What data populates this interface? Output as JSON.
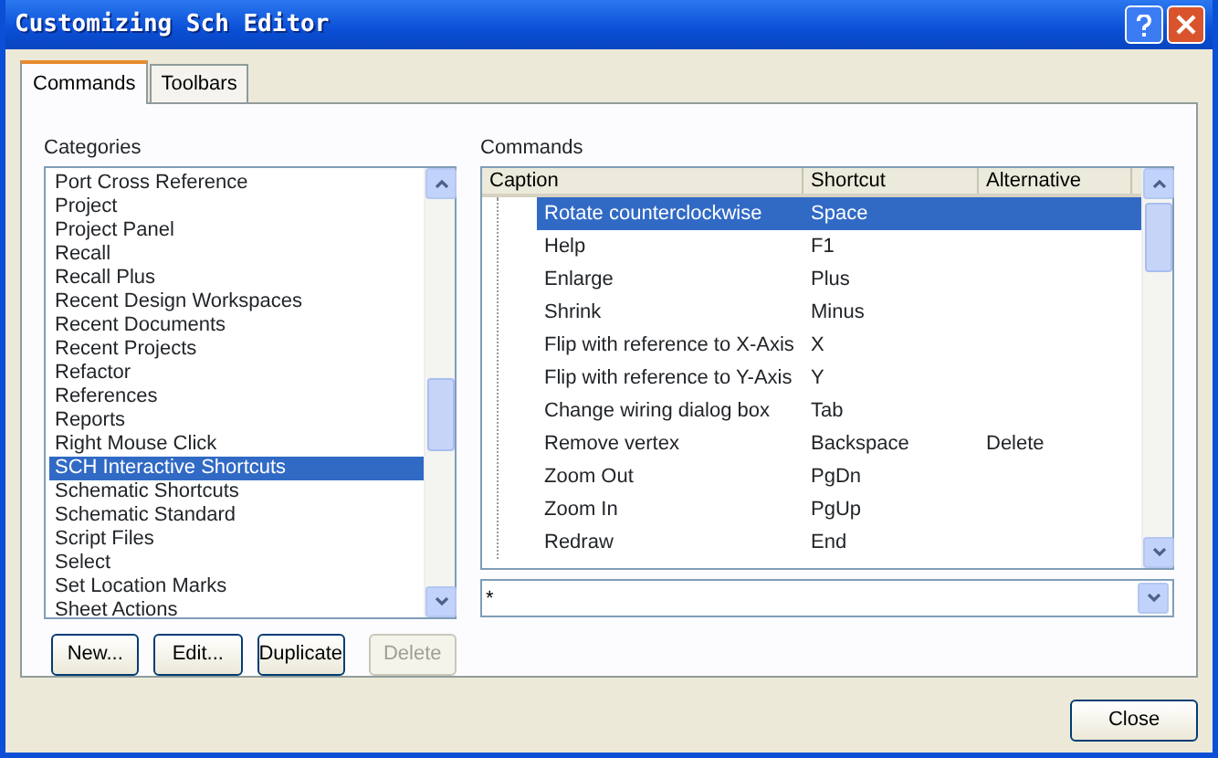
{
  "window": {
    "title": "Customizing Sch Editor"
  },
  "tabs": [
    {
      "label": "Commands",
      "selected": true
    },
    {
      "label": "Toolbars",
      "selected": false
    }
  ],
  "categories": {
    "label": "Categories",
    "items": [
      {
        "label": "Port Cross Reference",
        "selected": false
      },
      {
        "label": "Project",
        "selected": false
      },
      {
        "label": "Project Panel",
        "selected": false
      },
      {
        "label": "Recall",
        "selected": false
      },
      {
        "label": "Recall Plus",
        "selected": false
      },
      {
        "label": "Recent Design Workspaces",
        "selected": false
      },
      {
        "label": "Recent Documents",
        "selected": false
      },
      {
        "label": "Recent Projects",
        "selected": false
      },
      {
        "label": "Refactor",
        "selected": false
      },
      {
        "label": "References",
        "selected": false
      },
      {
        "label": "Reports",
        "selected": false
      },
      {
        "label": "Right Mouse Click",
        "selected": false
      },
      {
        "label": "SCH Interactive Shortcuts",
        "selected": true
      },
      {
        "label": "Schematic Shortcuts",
        "selected": false
      },
      {
        "label": "Schematic Standard",
        "selected": false
      },
      {
        "label": "Script Files",
        "selected": false
      },
      {
        "label": "Select",
        "selected": false
      },
      {
        "label": "Set Location Marks",
        "selected": false
      },
      {
        "label": "Sheet Actions",
        "selected": false
      }
    ]
  },
  "commands": {
    "label": "Commands",
    "columns": [
      "Caption",
      "Shortcut",
      "Alternative"
    ],
    "rows": [
      {
        "caption": "Rotate counterclockwise",
        "shortcut": "Space",
        "alternative": "",
        "selected": true
      },
      {
        "caption": "Help",
        "shortcut": "F1",
        "alternative": "",
        "selected": false
      },
      {
        "caption": "Enlarge",
        "shortcut": "Plus",
        "alternative": "",
        "selected": false
      },
      {
        "caption": "Shrink",
        "shortcut": "Minus",
        "alternative": "",
        "selected": false
      },
      {
        "caption": "Flip with reference to X-Axis",
        "shortcut": "X",
        "alternative": "",
        "selected": false
      },
      {
        "caption": "Flip with reference to Y-Axis",
        "shortcut": "Y",
        "alternative": "",
        "selected": false
      },
      {
        "caption": "Change wiring dialog box",
        "shortcut": "Tab",
        "alternative": "",
        "selected": false
      },
      {
        "caption": "Remove vertex",
        "shortcut": "Backspace",
        "alternative": "Delete",
        "selected": false
      },
      {
        "caption": "Zoom Out",
        "shortcut": "PgDn",
        "alternative": "",
        "selected": false
      },
      {
        "caption": "Zoom In",
        "shortcut": "PgUp",
        "alternative": "",
        "selected": false
      },
      {
        "caption": "Redraw",
        "shortcut": "End",
        "alternative": "",
        "selected": false
      }
    ],
    "filter": {
      "value": "*"
    }
  },
  "buttons": [
    {
      "label": "New...",
      "disabled": false
    },
    {
      "label": "Edit...",
      "disabled": false
    },
    {
      "label": "Duplicate",
      "disabled": false
    },
    {
      "label": "Delete",
      "disabled": true
    }
  ],
  "close_button": {
    "label": "Close"
  }
}
